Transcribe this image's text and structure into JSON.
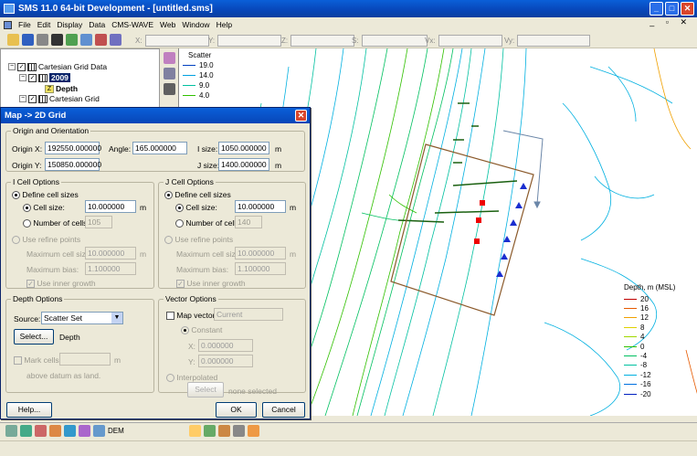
{
  "window": {
    "title": "SMS 11.0 64-bit Development - [untitled.sms]"
  },
  "menu": [
    "File",
    "Edit",
    "Display",
    "Data",
    "CMS-WAVE",
    "Web",
    "Window",
    "Help"
  ],
  "coords": {
    "x": "X:",
    "y": "Y:",
    "z": "Z:",
    "s": "S:",
    "vx": "Vx:",
    "vy": "Vy:"
  },
  "tree": {
    "root": "Cartesian Grid Data",
    "child": "2009",
    "dataset": "Depth",
    "grid": "Cartesian Grid"
  },
  "scatter_legend": {
    "title": "Scatter",
    "items": [
      "19.0",
      "14.0",
      "9.0",
      "4.0"
    ]
  },
  "depth_legend": {
    "title": "Depth, m (MSL)",
    "items": [
      {
        "label": "20",
        "color": "#c00000"
      },
      {
        "label": "16",
        "color": "#e65a00"
      },
      {
        "label": "12",
        "color": "#f0a000"
      },
      {
        "label": "8",
        "color": "#e0d000"
      },
      {
        "label": "4",
        "color": "#a0d800"
      },
      {
        "label": "0",
        "color": "#30c000"
      },
      {
        "label": "-4",
        "color": "#00c060"
      },
      {
        "label": "-8",
        "color": "#00c0a0"
      },
      {
        "label": "-12",
        "color": "#00b0e0"
      },
      {
        "label": "-16",
        "color": "#0070e0"
      },
      {
        "label": "-20",
        "color": "#0020c0"
      }
    ]
  },
  "dialog": {
    "title": "Map -> 2D Grid",
    "origin": {
      "legend": "Origin and Orientation",
      "origin_x_label": "Origin X:",
      "origin_x": "192550.000000",
      "origin_y_label": "Origin Y:",
      "origin_y": "150850.000000",
      "angle_label": "Angle:",
      "angle": "165.000000",
      "isize_label": "I size:",
      "isize": "1050.000000",
      "isize_unit": "m",
      "jsize_label": "J size:",
      "jsize": "1400.000000",
      "jsize_unit": "m"
    },
    "icell": {
      "legend": "I Cell Options",
      "define": "Define cell sizes",
      "cellsize_label": "Cell size:",
      "cellsize": "10.000000",
      "unit": "m",
      "numcells_label": "Number of cells:",
      "numcells": "105",
      "refine": "Use refine points",
      "maxcell_label": "Maximum cell size:",
      "maxcell": "10.000000",
      "maxbias_label": "Maximum bias:",
      "maxbias": "1.100000",
      "inner": "Use inner growth"
    },
    "jcell": {
      "legend": "J Cell Options",
      "define": "Define cell sizes",
      "cellsize_label": "Cell size:",
      "cellsize": "10.000000",
      "unit": "m",
      "numcells_label": "Number of cells:",
      "numcells": "140",
      "refine": "Use refine points",
      "maxcell_label": "Maximum cell size:",
      "maxcell": "10.000000",
      "maxbias_label": "Maximum bias:",
      "maxbias": "1.100000",
      "inner": "Use inner growth"
    },
    "depth": {
      "legend": "Depth Options",
      "source_label": "Source:",
      "source": "Scatter Set",
      "select": "Select...",
      "select_value": "Depth",
      "mark_label": "Mark cells",
      "mark_unit": "m",
      "above": "above datum as land."
    },
    "vector": {
      "legend": "Vector Options",
      "map_label": "Map vector",
      "map_value": "Current",
      "constant": "Constant",
      "x_label": "X:",
      "x": "0.000000",
      "y_label": "Y:",
      "y": "0.000000",
      "interp": "Interpolated",
      "select": "Select",
      "none": "none selected"
    },
    "help": "Help...",
    "ok": "OK",
    "cancel": "Cancel"
  },
  "statusbar": {
    "dem": "DEM"
  }
}
